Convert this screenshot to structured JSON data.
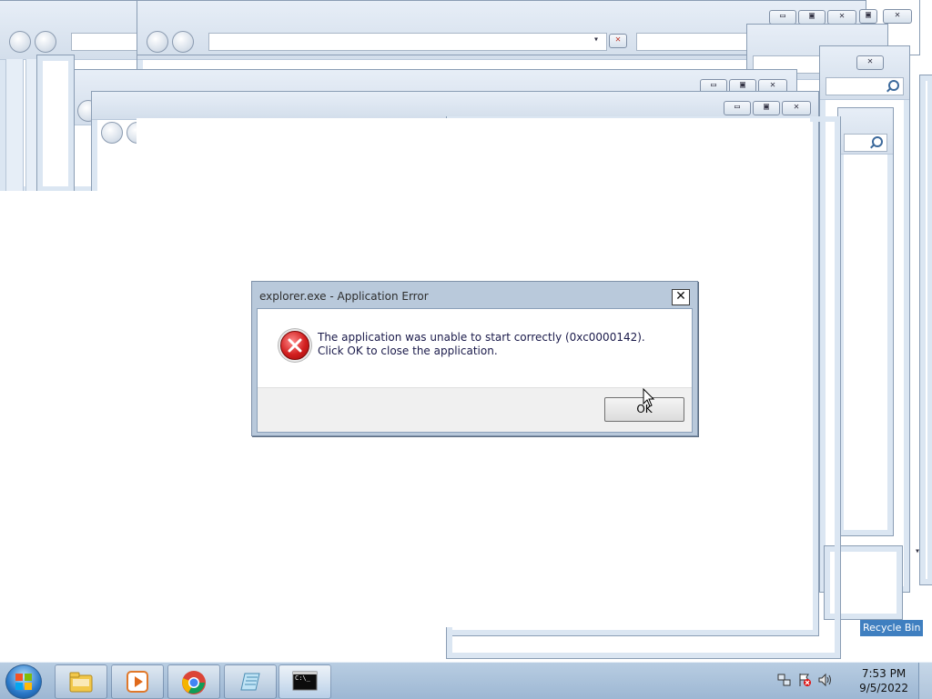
{
  "dialog": {
    "title": "explorer.exe - Application Error",
    "close_glyph": "✕",
    "message": "The application was unable to start correctly (0xc0000142). Click OK to close the application.",
    "ok_label": "OK",
    "icon": "error-icon"
  },
  "ghost_windows": {
    "minimize_glyph": "▭",
    "maximize_glyph": "▣",
    "close_glyph": "✕",
    "search_icon": "search-icon",
    "dropdown_glyph": "▾",
    "clear_glyph": "✕"
  },
  "desktop": {
    "recycle_bin_label": "Recycle Bin"
  },
  "taskbar": {
    "start_icon": "windows-logo-icon",
    "pinned": [
      {
        "name": "file-explorer-icon"
      },
      {
        "name": "media-player-icon"
      },
      {
        "name": "chrome-icon"
      },
      {
        "name": "notepad-icon"
      },
      {
        "name": "command-prompt-icon"
      }
    ],
    "cmd_glyph": "C:\\_",
    "tray_icons": [
      "network-icon",
      "action-center-flag-icon",
      "volume-icon"
    ],
    "time": "7:53 PM",
    "date": "9/5/2022"
  },
  "colors": {
    "taskbar": "#a9c2dc",
    "dialog_frame": "#b9c9db",
    "error_red": "#d21f1f",
    "message_text": "#1a1a4a"
  }
}
